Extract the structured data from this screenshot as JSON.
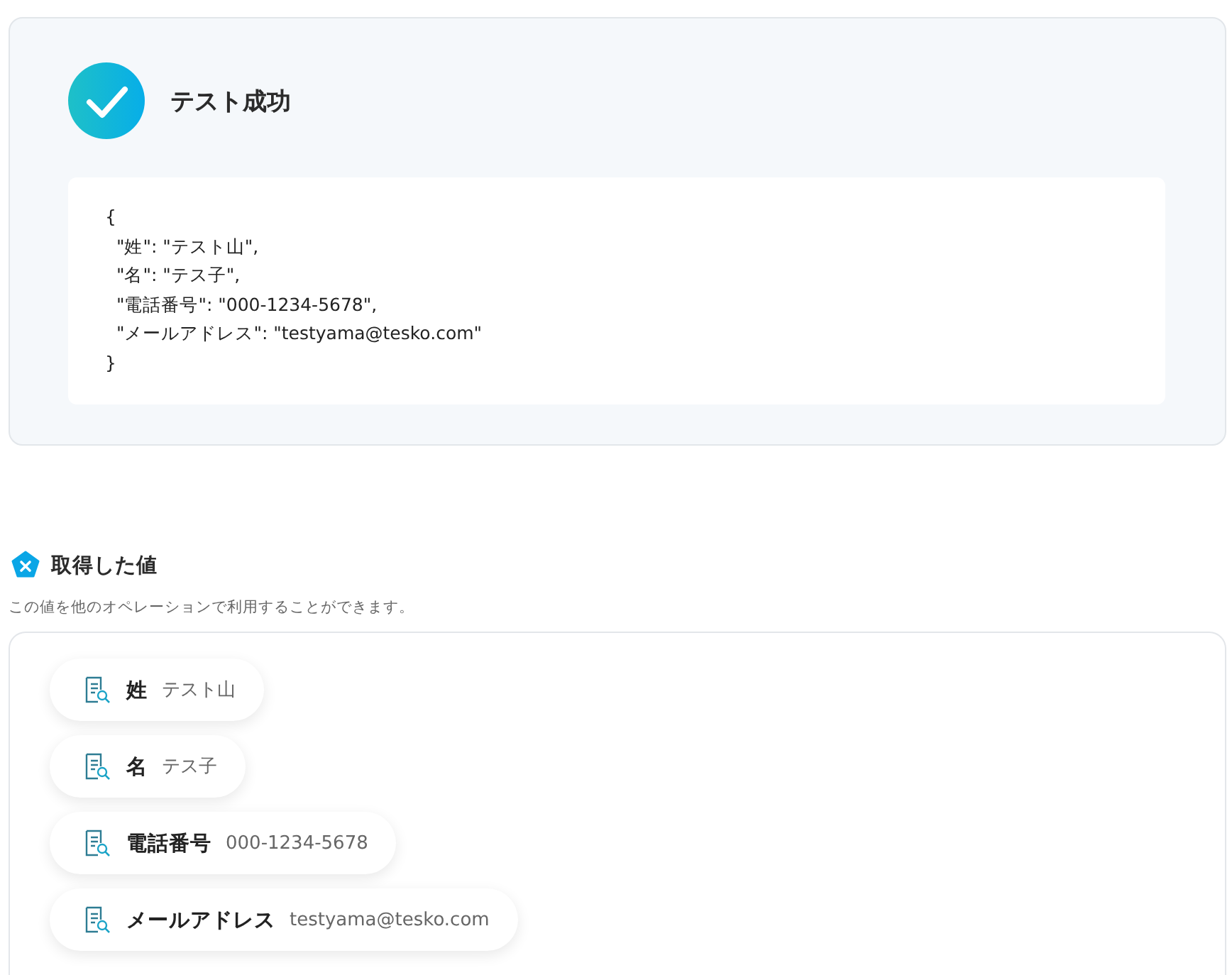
{
  "result": {
    "title": "テスト成功",
    "code_lines": [
      "{",
      "  \"姓\": \"テスト山\",",
      "  \"名\": \"テス子\",",
      "  \"電話番号\": \"000-1234-5678\",",
      "  \"メールアドレス\": \"testyama@tesko.com\"",
      "}"
    ]
  },
  "values_section": {
    "title": "取得した値",
    "description": "この値を他のオペレーションで利用することができます。",
    "items": [
      {
        "label": "姓",
        "value": "テスト山"
      },
      {
        "label": "名",
        "value": "テス子"
      },
      {
        "label": "電話番号",
        "value": "000-1234-5678"
      },
      {
        "label": "メールアドレス",
        "value": "testyama@tesko.com"
      }
    ]
  }
}
